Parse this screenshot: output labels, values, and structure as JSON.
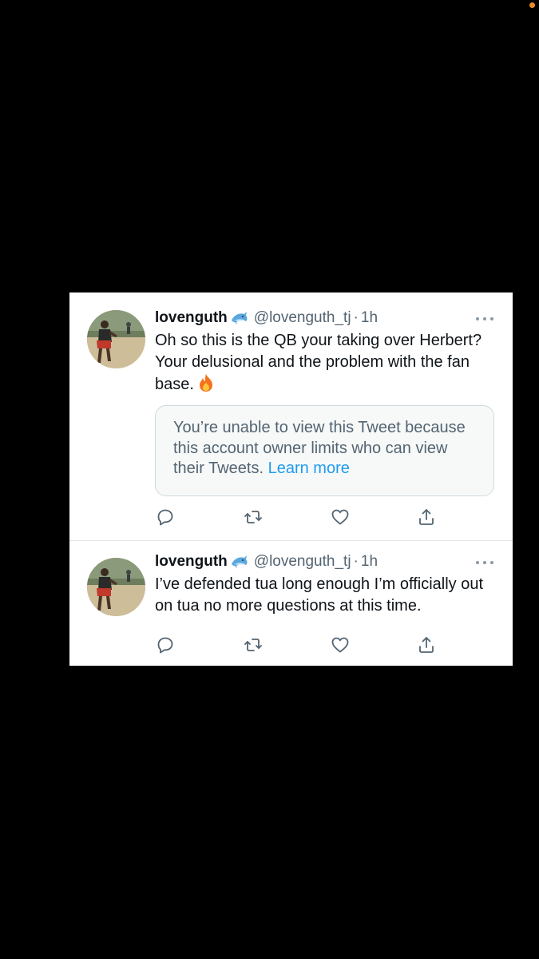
{
  "colors": {
    "background": "#000000",
    "card": "#ffffff",
    "text": "#0f1419",
    "secondary": "#536471",
    "link": "#1d9bf0",
    "quote_bg": "#f7f9f9",
    "status_dot": "#f08a24"
  },
  "tweets": [
    {
      "name": "lovenguth",
      "name_emoji": "dolphin-emoji",
      "handle": "@lovenguth_tj",
      "separator": "·",
      "time": "1h",
      "text": "Oh so this is the QB your taking over Herbert? Your delusional and the problem with the fan base.",
      "trailing_emoji": "fire-emoji",
      "quote": {
        "text": "You’re unable to view this Tweet because this account owner limits who can view their Tweets.",
        "link": "Learn more"
      },
      "actions": [
        "reply-icon",
        "retweet-icon",
        "like-icon",
        "share-icon"
      ]
    },
    {
      "name": "lovenguth",
      "name_emoji": "dolphin-emoji",
      "handle": "@lovenguth_tj",
      "separator": "·",
      "time": "1h",
      "text": "I’ve defended tua long enough I’m officially out on tua no more questions at this time.",
      "actions": [
        "reply-icon",
        "retweet-icon",
        "like-icon",
        "share-icon"
      ]
    }
  ]
}
